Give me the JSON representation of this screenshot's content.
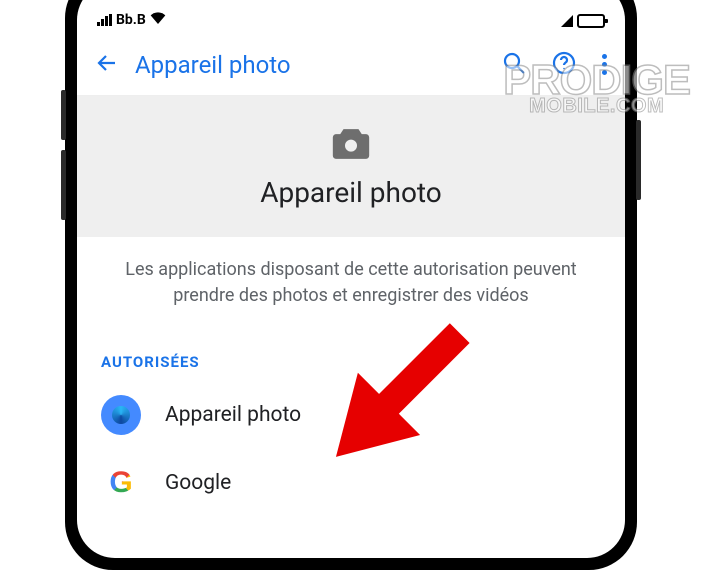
{
  "status_bar": {
    "carrier_text": "Bb.B"
  },
  "app_bar": {
    "title": "Appareil photo"
  },
  "hero": {
    "title": "Appareil photo"
  },
  "description": "Les applications disposant de cette autorisation peuvent prendre des photos et enregistrer des vidéos",
  "section_header": "AUTORISÉES",
  "apps": {
    "0": {
      "label": "Appareil photo"
    },
    "1": {
      "label": "Google"
    }
  },
  "watermark": {
    "line1": "PRODIGE",
    "line2": "MOBILE.COM"
  }
}
